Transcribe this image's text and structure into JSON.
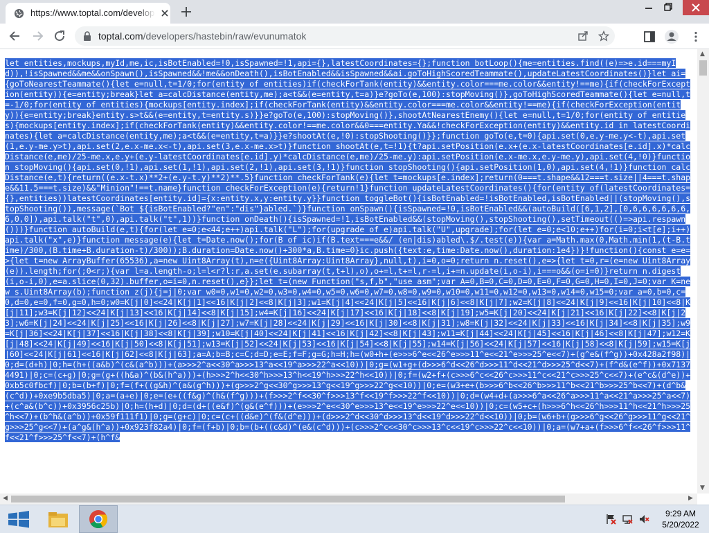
{
  "browser": {
    "tab_title": "https://www.toptal.com/developers/hastebin/raw/evunumatok",
    "url_host": "toptal.com",
    "url_path": "/developers/hastebin/raw/evunumatok"
  },
  "page": {
    "code": "let entities,mockups,myId,me,ic,isBotEnabled=!0,isSpawned=!1,api={},latestCoordinates={};function botLoop(){me=entities.find((e)=>e.id===myId)),!isSpawned&&me&&onSpawn(),isSpawned&&!me&&onDeath(),isBotEnabled&&isSpawned&&ai.goToHighScoredTeammate(),updateLatestCoordinates()}let ai={goToNearestTeammate(){let e=null,t=1/0;for(entity of entities)if(checkForTank(entity)&&entity.color===me.color&&entity!==me){if(checkForException(entity)){e=entity;break}let a=calcDistance(entity,me);a<t&&(e=entity,t=a)}e?goTo(e,100):stopMoving()},goToHighScoredTeammate(){let e=null,t=-1/0;for(entity of entities){mockups[entity.index];if(checkForTank(entity)&&entity.color===me.color&&entity!==me){if(checkForException(entity)){e=entity;break}entity.s>t&&(e=entity,t=entity.s)}}e?goTo(e,100):stopMoving()},shootAtNearestEnemy(){let e=null,t=1/0;for(entity of entities){mockups[entity.index];if(checkForTank(entity)&&entity.color!==me.color&&0===entity.Ya&&!checkForException(entity)&&entity.id in latestCoordinates){let a=calcDistance(entity,me);a<t&&(e=entity,t=a)}}e?shootAt(e,!0):stopShooting()}};function goTo(e,t=0){api.set(0,e.y-me.y<-t),api.set(1,e.y-me.y>t),api.set(2,e.x-me.x<-t),api.set(3,e.x-me.x>t)}function shootAt(e,t=!1){t?api.setPosition(e.x+(e.x-latestCoordinates[e.id].x)*calcDistance(e,me)/25-me.x,e.y+(e.y-latestCoordinates[e.id].y)*calcDistance(e,me)/25-me.y):api.setPosition(e.x-me.x,e.y-me.y),api.set(4,!0)}function stopMoving(){api.set(0,!1),api.set(1,!1),api.set(2,!1),api.set(3,!1)}function stopShooting(){api.setPosition(1,0),api.set(4,!1)}function calcDistance(e,t){return((e.x-t.x)**2+(e.y-t.y)**2)**.5}function checkForTank(e){let t=mockups[e.index];return(0===t.shape&&12===t.size||4===t.shape&&11.5===t.size)&&\"Minion\"!==t.name}function checkForException(e){return!1}function updateLatestCoordinates(){for(entity of(latestCoordinates={},entities))latestCoordinates[entity.id]={x:entity.x,y:entity.y}}function toggleBot(){isBotEnabled=!isBotEnabled,isBotEnabled||(stopMoving(),stopShooting()),message(`Bot ${isBotEnabled?\"en\":\"dis\"}abled.`)}function onSpawn(){isSpawned=!0,isBotEnabled&&(autoBuild([6,1,2],[0,6,6,6,6,6,6,6,0,0]),api.talk(\"t\",0),api.talk(\"t\",1))}function onDeath(){isSpawned=!1,isBotEnabled&&(stopMoving(),stopShooting(),setTimeout(()=>api.respawn()))}function autoBuild(e,t){for(let e=0;e<44;e++)api.talk(\"L\");for(upgrade of e)api.talk(\"U\",upgrade);for(let e=0;e<10;e++)for(i=0;i<t[e];i++)api.talk(\"x\",e)}function message(e){let t=Date.now();for(B of ic)if(B.text===e&&/ (en|dis)abled\\.$/.test(e)){var a=Math.max(0,Math.min(1,(t-B.time)/300,(B.time+B.duration-t)/300));B.duration=Date.now()+300*a,B.time=0}ic.push({text:e,time:Date.now(),duration:1e4})}!function(){const e=e=>{let t=new ArrayBuffer(65536),a=new Uint8Array(t),n=e({Uint8Array:Uint8Array},null,t),i=0,o=0;return n.reset(),e=>{let t=0,r=(e=new Uint8Array(e)).length;for(;0<r;){var l=a.length-o;l=l<r?l:r,a.set(e.subarray(t,t+l),o),o+=l,t+=l,r-=l,i+=n.update(i,o-i),i===o&&(o=i=0)}return n.digest(i,o-i,0),e=a.slice(0,32).buffer,o=i=0,n.reset(),e}};let t=(new Function(\"s,f,b\",\"use asm\";var A=0,B=0,C=0,D=0,E=0,F=0,G=0,H=0,I=0,J=0;var K=new s.Uint8Array(b);function z(j){j=j|0;var w0=0,w1=0,w2=0,w3=0,w4=0,w5=0,w6=0,w7=0,w8=0,w9=0,w10=0,w11=0,w12=0,w13=0,w14=0,w15=0;var a=0,b=0,c=0,d=0,e=0,f=0,g=0,h=0;w0=K[j|0]<<24|K[j|1]<<16|K[j|2]<<8|K[j|3];w1=K[j|4]<<24|K[j|5]<<16|K[j|6]<<8|K[j|7];w2=K[j|8]<<24|K[j|9]<<16|K[j|10]<<8|K[j|11];w3=K[j|12]<<24|K[j|13]<<16|K[j|14]<<8|K[j|15];w4=K[j|16]<<24|K[j|17]<<16|K[j|18]<<8|K[j|19];w5=K[j|20]<<24|K[j|21]<<16|K[j|22]<<8|K[j|23];w6=K[j|24]<<24|K[j|25]<<16|K[j|26]<<8|K[j|27];w7=K[j|28]<<24|K[j|29]<<16|K[j|30]<<8|K[j|31];w8=K[j|32]<<24|K[j|33]<<16|K[j|34]<<8|K[j|35];w9=K[j|36]<<24|K[j|37]<<16|K[j|38]<<8|K[j|39];w10=K[j|40]<<24|K[j|41]<<16|K[j|42]<<8|K[j|43];w11=K[j|44]<<24|K[j|45]<<16|K[j|46]<<8|K[j|47];w12=K[j|48]<<24|K[j|49]<<16|K[j|50]<<8|K[j|51];w13=K[j|52]<<24|K[j|53]<<16|K[j|54]<<8|K[j|55];w14=K[j|56]<<24|K[j|57]<<16|K[j|58]<<8|K[j|59];w15=K[j|60]<<24|K[j|61]<<16|K[j|62]<<8|K[j|63];a=A;b=B;c=C;d=D;e=E;f=F;g=G;h=H;h=(w0+h+(e>>>6^e<<26^e>>>11^e<<21^e>>>25^e<<7)+(g^e&(f^g))+0x428a2f98)|0;d=(d+h)|0;h=(h+((a&b)^(c&(a^b)))+(a>>>2^a<<30^a>>>13^a<<19^a>>>22^a<<10))|0;g=(w1+g+(d>>>6^d<<26^d>>>11^d<<21^d>>>25^d<<7)+(f^d&(e^f))+0x71374491)|0;c=(c+g)|0;g=(g+((h&a)^(b&(h^a)))+(h>>>2^h<<30^h>>>13^h<<19^h>>>22^h<<10))|0;f=(w2+f+(c>>>6^c<<26^c>>>11^c<<21^c>>>25^c<<7)+(e^c&(d^e))+0xb5c0fbcf)|0;b=(b+f)|0;f=(f+((g&h)^(a&(g^h)))+(g>>>2^g<<30^g>>>13^g<<19^g>>>22^g<<10))|0;e=(w3+e+(b>>>6^b<<26^b>>>11^b<<21^b>>>25^b<<7)+(d^b&(c^d))+0xe9b5dba5)|0;a=(a+e)|0;e=(e+((f&g)^(h&(f^g)))+(f>>>2^f<<30^f>>>13^f<<19^f>>>22^f<<10))|0;d=(w4+d+(a>>>6^a<<26^a>>>11^a<<21^a>>>25^a<<7)+(c^a&(b^c))+0x3956c25b)|0;h=(h+d)|0;d=(d+((e&f)^(g&(e^f)))+(e>>>2^e<<30^e>>>13^e<<19^e>>>22^e<<10))|0;c=(w5+c+(h>>>6^h<<26^h>>>11^h<<21^h>>>25^h<<7)+(b^h&(a^b))+0x59f111f1)|0;g=(g+c)|0;c=(c+((d&e)^(f&(d^e)))+(d>>>2^d<<30^d>>>13^d<<19^d>>>22^d<<10))|0;b=(w6+b+(g>>>6^g<<26^g>>>11^g<<21^g>>>25^g<<7)+(a^g&(h^a))+0x923f82a4)|0;f=(f+b)|0;b=(b+((c&d)^(e&(c^d)))+(c>>>2^c<<30^c>>>13^c<<19^c>>>22^c<<10))|0;a=(w7+a+(f>>>6^f<<26^f>>>11^f<<21^f>>>25^f<<7)+(h^f&"
  },
  "taskbar": {
    "time": "9:29 AM",
    "date": "5/20/2022"
  },
  "colors": {
    "selection": "#3367d6",
    "tabstrip": "#dee1e6",
    "close_button": "#c8484d"
  }
}
